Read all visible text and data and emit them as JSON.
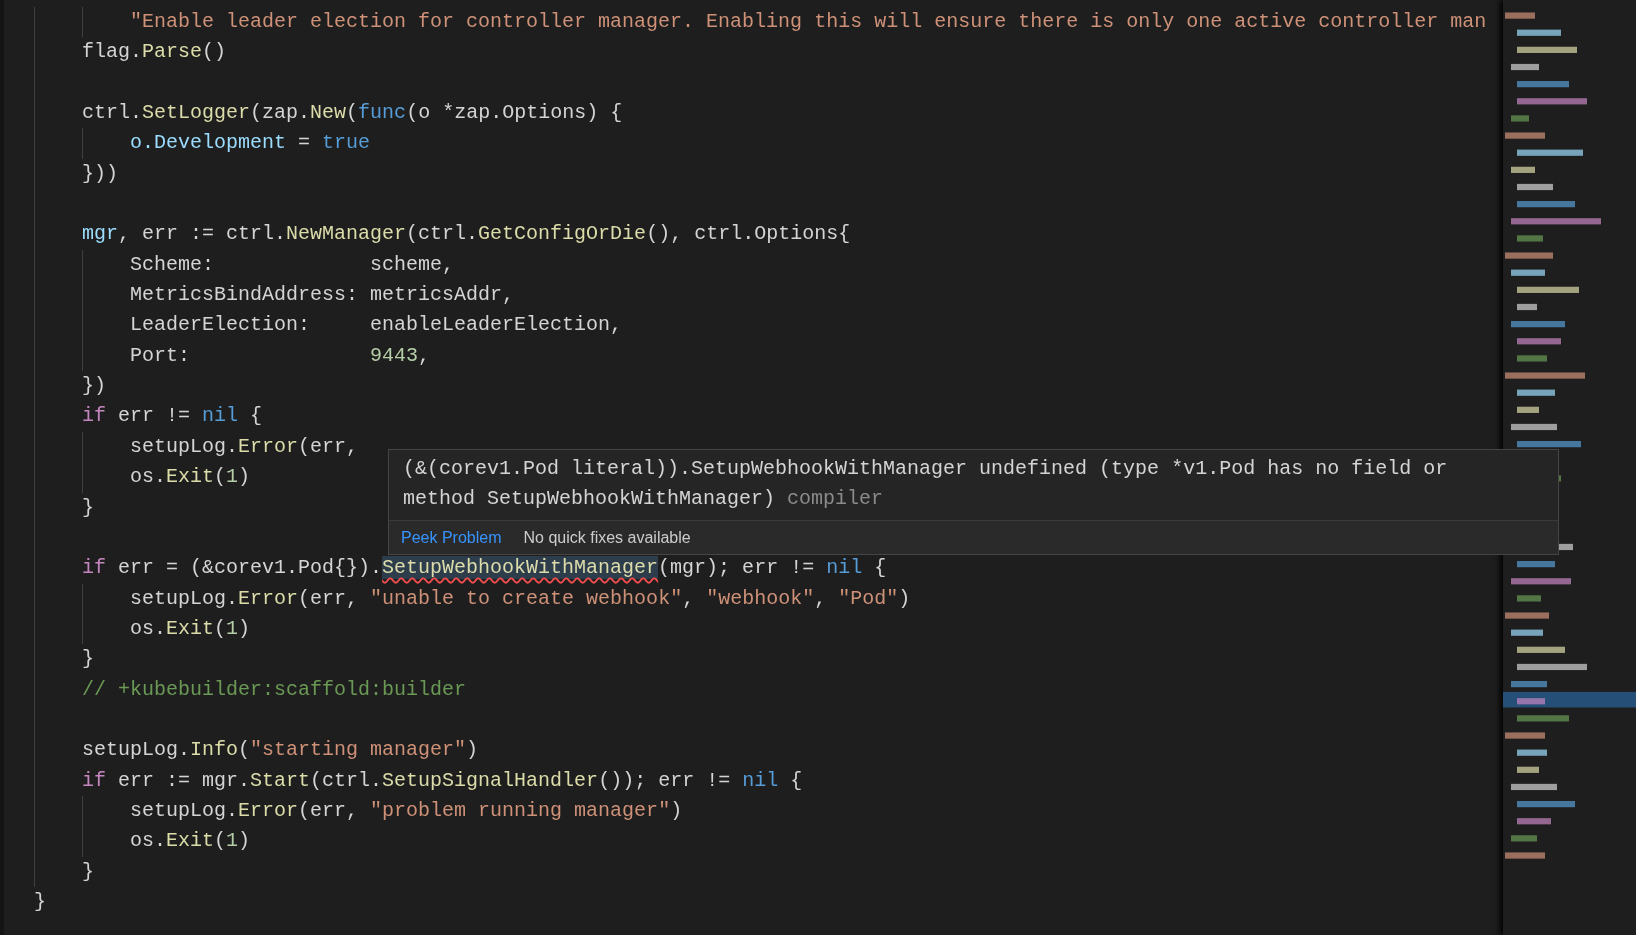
{
  "lines": [
    {
      "kind": "code",
      "tokens": [
        {
          "text": "        \"Enable leader election for controller manager. Enabling this will ensure there is only one active controller man",
          "kind": "string"
        }
      ]
    },
    {
      "kind": "code",
      "tokens": [
        {
          "text": "    flag.",
          "kind": "plain"
        },
        {
          "text": "Parse",
          "kind": "func"
        },
        {
          "text": "()",
          "kind": "plain"
        }
      ]
    },
    {
      "kind": "blank"
    },
    {
      "kind": "code",
      "tokens": [
        {
          "text": "    ctrl.",
          "kind": "plain"
        },
        {
          "text": "SetLogger",
          "kind": "func"
        },
        {
          "text": "(zap.",
          "kind": "plain"
        },
        {
          "text": "New",
          "kind": "func"
        },
        {
          "text": "(",
          "kind": "plain"
        },
        {
          "text": "func",
          "kind": "keyword"
        },
        {
          "text": "(o *zap.Options) {",
          "kind": "plain"
        }
      ]
    },
    {
      "kind": "code",
      "tokens": [
        {
          "text": "        o.Development",
          "kind": "variable"
        },
        {
          "text": " = ",
          "kind": "plain"
        },
        {
          "text": "true",
          "kind": "keyword"
        }
      ]
    },
    {
      "kind": "code",
      "tokens": [
        {
          "text": "    }))",
          "kind": "plain"
        }
      ]
    },
    {
      "kind": "blank"
    },
    {
      "kind": "code",
      "tokens": [
        {
          "text": "    mgr",
          "kind": "variable"
        },
        {
          "text": ", err := ctrl.",
          "kind": "plain"
        },
        {
          "text": "NewManager",
          "kind": "func"
        },
        {
          "text": "(ctrl.",
          "kind": "plain"
        },
        {
          "text": "GetConfigOrDie",
          "kind": "func"
        },
        {
          "text": "(), ctrl.Options{",
          "kind": "plain"
        }
      ]
    },
    {
      "kind": "code",
      "tokens": [
        {
          "text": "        Scheme:             scheme,",
          "kind": "plain"
        }
      ]
    },
    {
      "kind": "code",
      "tokens": [
        {
          "text": "        MetricsBindAddress: metricsAddr,",
          "kind": "plain"
        }
      ]
    },
    {
      "kind": "code",
      "tokens": [
        {
          "text": "        LeaderElection:     enableLeaderElection,",
          "kind": "plain"
        }
      ]
    },
    {
      "kind": "code",
      "tokens": [
        {
          "text": "        Port:               ",
          "kind": "plain"
        },
        {
          "text": "9443",
          "kind": "number"
        },
        {
          "text": ",",
          "kind": "plain"
        }
      ]
    },
    {
      "kind": "code",
      "tokens": [
        {
          "text": "    })",
          "kind": "plain"
        }
      ]
    },
    {
      "kind": "code",
      "tokens": [
        {
          "text": "    if",
          "kind": "control"
        },
        {
          "text": " err != ",
          "kind": "plain"
        },
        {
          "text": "nil",
          "kind": "keyword"
        },
        {
          "text": " {",
          "kind": "plain"
        }
      ]
    },
    {
      "kind": "code",
      "tokens": [
        {
          "text": "        setupLog.",
          "kind": "plain"
        },
        {
          "text": "Error",
          "kind": "func"
        },
        {
          "text": "(err, ",
          "kind": "plain"
        }
      ]
    },
    {
      "kind": "code",
      "tokens": [
        {
          "text": "        os.",
          "kind": "plain"
        },
        {
          "text": "Exit",
          "kind": "func"
        },
        {
          "text": "(",
          "kind": "plain"
        },
        {
          "text": "1",
          "kind": "number"
        },
        {
          "text": ")",
          "kind": "plain"
        }
      ]
    },
    {
      "kind": "code",
      "tokens": [
        {
          "text": "    }",
          "kind": "plain"
        }
      ]
    },
    {
      "kind": "blank"
    },
    {
      "kind": "code",
      "tokens": [
        {
          "text": "    if",
          "kind": "control"
        },
        {
          "text": " err = (&corev1.Pod{}).",
          "kind": "plain"
        },
        {
          "text": "SetupWebhookWithManager",
          "kind": "func",
          "error": true
        },
        {
          "text": "(mgr); err != ",
          "kind": "plain"
        },
        {
          "text": "nil",
          "kind": "keyword"
        },
        {
          "text": " {",
          "kind": "plain"
        }
      ]
    },
    {
      "kind": "code",
      "tokens": [
        {
          "text": "        setupLog.",
          "kind": "plain"
        },
        {
          "text": "Error",
          "kind": "func"
        },
        {
          "text": "(err, ",
          "kind": "plain"
        },
        {
          "text": "\"unable to create webhook\"",
          "kind": "string"
        },
        {
          "text": ", ",
          "kind": "plain"
        },
        {
          "text": "\"webhook\"",
          "kind": "string"
        },
        {
          "text": ", ",
          "kind": "plain"
        },
        {
          "text": "\"Pod\"",
          "kind": "string"
        },
        {
          "text": ")",
          "kind": "plain"
        }
      ]
    },
    {
      "kind": "code",
      "tokens": [
        {
          "text": "        os.",
          "kind": "plain"
        },
        {
          "text": "Exit",
          "kind": "func"
        },
        {
          "text": "(",
          "kind": "plain"
        },
        {
          "text": "1",
          "kind": "number"
        },
        {
          "text": ")",
          "kind": "plain"
        }
      ]
    },
    {
      "kind": "code",
      "tokens": [
        {
          "text": "    }",
          "kind": "plain"
        }
      ]
    },
    {
      "kind": "code",
      "tokens": [
        {
          "text": "    // +kubebuilder:scaffold:builder",
          "kind": "comment"
        }
      ]
    },
    {
      "kind": "blank"
    },
    {
      "kind": "code",
      "tokens": [
        {
          "text": "    setupLog.",
          "kind": "plain"
        },
        {
          "text": "Info",
          "kind": "func"
        },
        {
          "text": "(",
          "kind": "plain"
        },
        {
          "text": "\"starting manager\"",
          "kind": "string"
        },
        {
          "text": ")",
          "kind": "plain"
        }
      ]
    },
    {
      "kind": "code",
      "tokens": [
        {
          "text": "    if",
          "kind": "control"
        },
        {
          "text": " err := mgr.",
          "kind": "plain"
        },
        {
          "text": "Start",
          "kind": "func"
        },
        {
          "text": "(ctrl.",
          "kind": "plain"
        },
        {
          "text": "SetupSignalHandler",
          "kind": "func"
        },
        {
          "text": "()); err != ",
          "kind": "plain"
        },
        {
          "text": "nil",
          "kind": "keyword"
        },
        {
          "text": " {",
          "kind": "plain"
        }
      ]
    },
    {
      "kind": "code",
      "tokens": [
        {
          "text": "        setupLog.",
          "kind": "plain"
        },
        {
          "text": "Error",
          "kind": "func"
        },
        {
          "text": "(err, ",
          "kind": "plain"
        },
        {
          "text": "\"problem running manager\"",
          "kind": "string"
        },
        {
          "text": ")",
          "kind": "plain"
        }
      ]
    },
    {
      "kind": "code",
      "tokens": [
        {
          "text": "        os.",
          "kind": "plain"
        },
        {
          "text": "Exit",
          "kind": "func"
        },
        {
          "text": "(",
          "kind": "plain"
        },
        {
          "text": "1",
          "kind": "number"
        },
        {
          "text": ")",
          "kind": "plain"
        }
      ]
    },
    {
      "kind": "code",
      "tokens": [
        {
          "text": "    }",
          "kind": "plain"
        }
      ]
    },
    {
      "kind": "code",
      "tokens": [
        {
          "text": "}",
          "kind": "plain"
        }
      ]
    }
  ],
  "hover": {
    "message": "(&(corev1.Pod literal)).SetupWebhookWithManager undefined (type *v1.Pod has no field or method SetupWebhookWithManager)",
    "source": "compiler",
    "actions": [
      {
        "label": "Peek Problem"
      }
    ],
    "status": "No quick fixes available"
  }
}
